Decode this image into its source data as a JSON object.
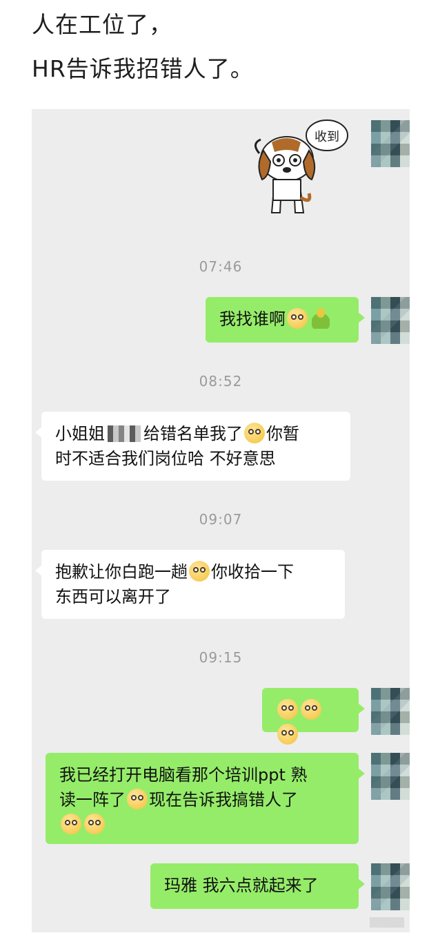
{
  "caption": {
    "line1": "人在工位了，",
    "line2": "HR告诉我招错人了。"
  },
  "sticker": {
    "bubble_text": "收到"
  },
  "messages": {
    "t1": "07:46",
    "m1": "我找谁啊",
    "t2": "08:52",
    "m2_a": "小姐姐",
    "m2_b": "给错名单我了",
    "m2_c": "你暂",
    "m2_d": "时不适合我们岗位哈 不好意思",
    "t3": "09:07",
    "m3_a": "抱歉让你白跑一趟",
    "m3_b": "你收拾一下",
    "m3_c": "东西可以离开了",
    "t4": "09:15",
    "m5_a": "我已经打开电脑看那个培训ppt 熟",
    "m5_b": "读一阵了",
    "m5_c": "现在告诉我搞错人了",
    "m6": "玛雅 我六点就起来了"
  },
  "icons": [
    "doge-emoji",
    "plant-emoji",
    "facepalm-emoji",
    "tired-emoji",
    "avatar"
  ],
  "colors": {
    "me_bubble": "#95ec69",
    "them_bubble": "#ffffff",
    "chat_bg": "#ededed"
  }
}
